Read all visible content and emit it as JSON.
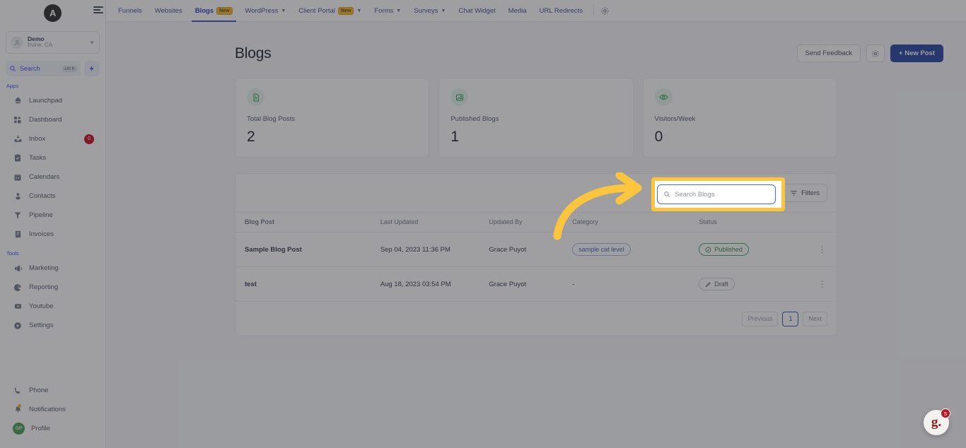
{
  "sidebar": {
    "brand_initial": "A",
    "agency": {
      "name": "Demo",
      "location": "Irvine, CA",
      "icon": "user-circle-icon",
      "chevron": "chevron-down-icon"
    },
    "search": {
      "label": "Search",
      "shortcut": "ctrl K",
      "icon": "search-icon",
      "bolt_icon": "lightning-bolt-icon"
    },
    "groups": [
      {
        "label": "Apps",
        "items": [
          {
            "label": "Launchpad",
            "icon": "rocket-icon",
            "badge": ""
          },
          {
            "label": "Dashboard",
            "icon": "grid-icon",
            "badge": ""
          },
          {
            "label": "Inbox",
            "icon": "inbox-icon",
            "badge": "0"
          },
          {
            "label": "Tasks",
            "icon": "clipboard-check-icon",
            "badge": ""
          },
          {
            "label": "Calendars",
            "icon": "calendar-icon",
            "badge": ""
          },
          {
            "label": "Contacts",
            "icon": "user-icon",
            "badge": ""
          },
          {
            "label": "Pipeline",
            "icon": "funnel-icon",
            "badge": ""
          },
          {
            "label": "Invoices",
            "icon": "invoice-icon",
            "badge": ""
          }
        ]
      },
      {
        "label": "Tools",
        "items": [
          {
            "label": "Marketing",
            "icon": "megaphone-icon",
            "badge": ""
          },
          {
            "label": "Reporting",
            "icon": "pie-chart-icon",
            "badge": ""
          },
          {
            "label": "Youtube",
            "icon": "youtube-icon",
            "badge": ""
          },
          {
            "label": "Settings",
            "icon": "gear-icon",
            "badge": ""
          }
        ]
      }
    ],
    "bottom_items": [
      {
        "label": "Phone",
        "icon": "phone-icon"
      },
      {
        "label": "Notifications",
        "icon": "bell-icon"
      },
      {
        "label": "Profile",
        "icon": "avatar-gp",
        "initials": "GP"
      }
    ]
  },
  "topbar": {
    "menu_icon": "hamburger-icon",
    "gear_icon": "gear-icon",
    "tabs": [
      {
        "label": "Funnels",
        "badge": "",
        "caret": false,
        "active": false
      },
      {
        "label": "Websites",
        "badge": "",
        "caret": false,
        "active": false
      },
      {
        "label": "Blogs",
        "badge": "New",
        "caret": false,
        "active": true
      },
      {
        "label": "WordPress",
        "badge": "",
        "caret": true,
        "active": false
      },
      {
        "label": "Client Portal",
        "badge": "New",
        "caret": true,
        "active": false
      },
      {
        "label": "Forms",
        "badge": "",
        "caret": true,
        "active": false
      },
      {
        "label": "Surveys",
        "badge": "",
        "caret": true,
        "active": false
      },
      {
        "label": "Chat Widget",
        "badge": "",
        "caret": false,
        "active": false
      },
      {
        "label": "Media",
        "badge": "",
        "caret": false,
        "active": false
      },
      {
        "label": "URL Redirects",
        "badge": "",
        "caret": false,
        "active": false
      }
    ]
  },
  "page": {
    "title": "Blogs",
    "actions": {
      "send_feedback": "Send Feedback",
      "settings_icon": "gear-icon",
      "new_post": "+ New Post"
    }
  },
  "stats": [
    {
      "label": "Total Blog Posts",
      "value": "2",
      "icon": "document-text-icon"
    },
    {
      "label": "Published Blogs",
      "value": "1",
      "icon": "image-sparkle-icon"
    },
    {
      "label": "Visitors/Week",
      "value": "0",
      "icon": "eye-icon"
    }
  ],
  "table": {
    "search": {
      "placeholder": "Search Blogs",
      "value": "",
      "icon": "search-icon"
    },
    "filters_label": "Filters",
    "filters_icon": "filter-icon",
    "columns": [
      "Blog Post",
      "Last Updated",
      "Updated By",
      "Category",
      "Status",
      ""
    ],
    "rows": [
      {
        "blog_post": "Sample Blog Post",
        "last_updated": "Sep 04, 2023 11:36 PM",
        "updated_by": "Grace Puyot",
        "category": "sample cat level",
        "status": "Published",
        "status_icon": "check-circle-icon",
        "menu_icon": "kebab-menu-icon"
      },
      {
        "blog_post": "test",
        "last_updated": "Aug 18, 2023 03:54 PM",
        "updated_by": "Grace Puyot",
        "category": "-",
        "status": "Draft",
        "status_icon": "pencil-icon",
        "menu_icon": "kebab-menu-icon"
      }
    ],
    "pagination": {
      "previous": "Previous",
      "current_page": "1",
      "next": "Next"
    }
  },
  "support_widget": {
    "logo_text": "g.",
    "badge_count": "5"
  },
  "annotation": {
    "highlight_target": "search-blogs-input",
    "arrow": "curved-right-arrow",
    "color": "#fbc63e"
  },
  "colors": {
    "accent_blue": "#1b3d9b",
    "nav_blue": "#3b4a8c",
    "badge_yellow": "#f5b324",
    "green": "#1f9d55",
    "red": "#c4001a",
    "highlight_yellow": "#fbc63e"
  }
}
